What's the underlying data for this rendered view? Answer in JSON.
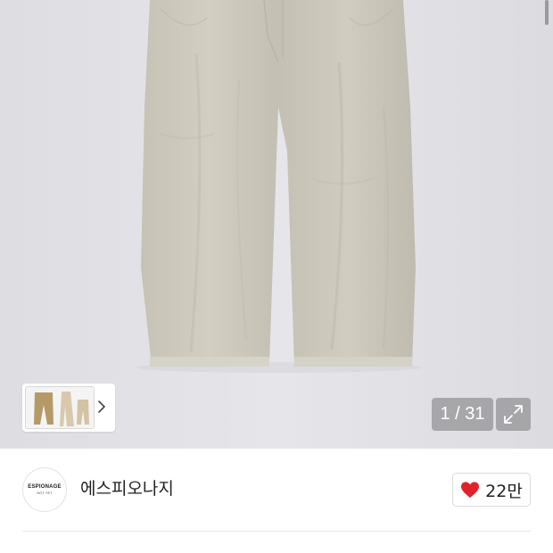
{
  "viewer": {
    "page_counter": "1 / 31",
    "expand_icon": "expand-arrows-icon",
    "thumbnail_next_icon": "chevron-right-icon",
    "product_colors": {
      "pants": "#c9c5b8",
      "background": "#e3e3e7"
    }
  },
  "store": {
    "logo_text": "ESPIONAGE",
    "logo_subtext": "NOT YET",
    "name": "에스피오나지",
    "like_icon": "heart-icon",
    "like_color": "#e0232a",
    "like_count": "22만"
  }
}
